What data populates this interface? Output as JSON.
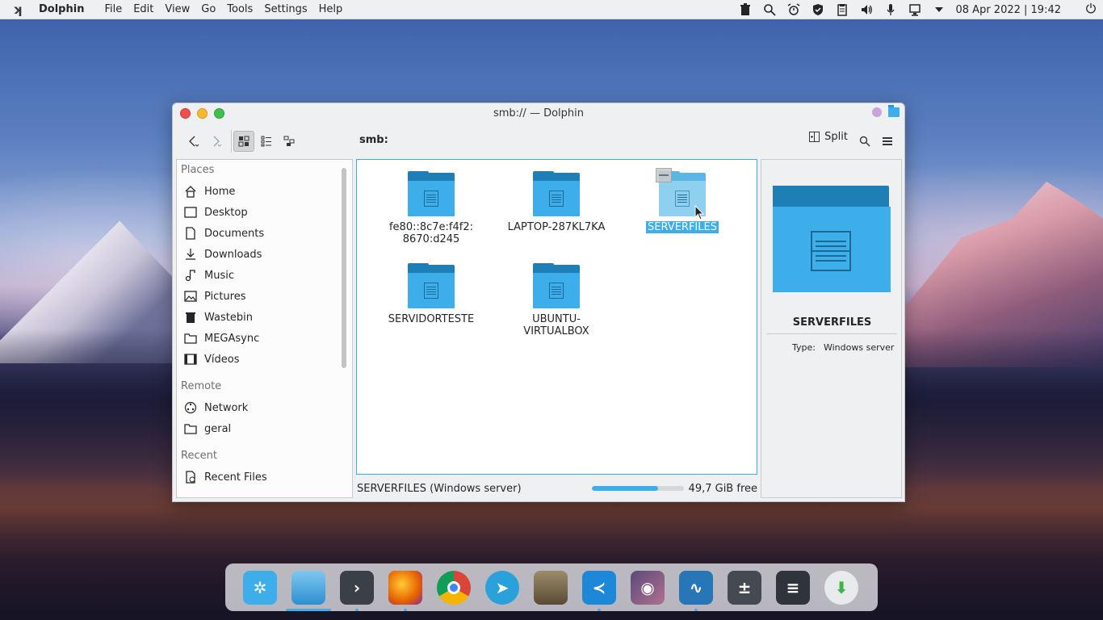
{
  "topbar": {
    "app_name": "Dolphin",
    "menu": [
      "File",
      "Edit",
      "View",
      "Go",
      "Tools",
      "Settings",
      "Help"
    ],
    "clock": "08 Apr 2022 | 19:42"
  },
  "window": {
    "title": "smb:// — Dolphin",
    "location": "smb:",
    "split_label": "Split"
  },
  "places": {
    "sections": [
      {
        "title": "Places",
        "items": [
          "Home",
          "Desktop",
          "Documents",
          "Downloads",
          "Music",
          "Pictures",
          "Wastebin",
          "MEGAsync",
          "Vídeos"
        ]
      },
      {
        "title": "Remote",
        "items": [
          "Network",
          "geral"
        ]
      },
      {
        "title": "Recent",
        "items": [
          "Recent Files"
        ]
      }
    ]
  },
  "files": [
    {
      "name": "fe80::8c7e:f4f2:\n8670:d245",
      "line1": "fe80::8c7e:f4f2:",
      "line2": "8670:d245"
    },
    {
      "name": "LAPTOP-287KL7KA",
      "line1": "LAPTOP-287KL7KA",
      "line2": ""
    },
    {
      "name": "SERVERFILES",
      "line1": "SERVERFILES",
      "line2": "",
      "selected": true
    },
    {
      "name": "SERVIDORTESTE",
      "line1": "SERVIDORTESTE",
      "line2": ""
    },
    {
      "name": "UBUNTU-VIRTUALBOX",
      "line1": "UBUNTU-",
      "line2": "VIRTUALBOX"
    }
  ],
  "status": {
    "text": "SERVERFILES (Windows server)",
    "free": "49,7 GiB free",
    "used_fraction": 0.72
  },
  "info": {
    "name": "SERVERFILES",
    "type_label": "Type:",
    "type_value": "Windows server"
  },
  "dock": [
    {
      "name": "kde-menu",
      "color": "#3daee9"
    },
    {
      "name": "dolphin",
      "color": "#2c8fd0"
    },
    {
      "name": "konsole",
      "color": "#31363b"
    },
    {
      "name": "firefox",
      "color": "#e66000"
    },
    {
      "name": "chrome",
      "color": "#db4437"
    },
    {
      "name": "telegram",
      "color": "#2aa1da"
    },
    {
      "name": "gimp",
      "color": "#8a7a5a"
    },
    {
      "name": "vscode",
      "color": "#1e88d8"
    },
    {
      "name": "spectacle",
      "color": "#6b5a8a"
    },
    {
      "name": "system-monitor",
      "color": "#2676b8"
    },
    {
      "name": "calculator",
      "color": "#444a50"
    },
    {
      "name": "system-settings",
      "color": "#2f343a"
    },
    {
      "name": "downloader",
      "color": "#3db54a"
    }
  ]
}
